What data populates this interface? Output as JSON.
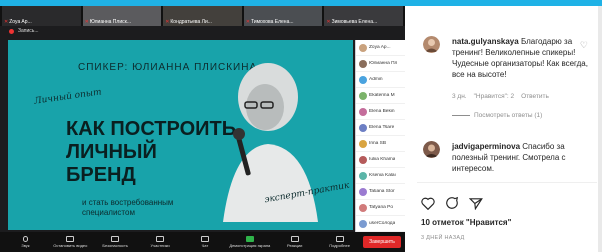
{
  "zoom": {
    "tiles": [
      {
        "name": "Zoya Ap..."
      },
      {
        "name": "Юлианна Плиск..."
      },
      {
        "name": "Кондратьева Ли..."
      },
      {
        "name": "Тимохова Елена..."
      },
      {
        "name": "Зимовьева Елена..."
      }
    ],
    "rec_label": "Запись...",
    "slide": {
      "speaker": "СПИКЕР: ЮЛИАННА ПЛИСКИНА",
      "handwritten_left": "Личный опыт",
      "title": "КАК ПОСТРОИТЬ\nЛИЧНЫЙ\nБРЕНД",
      "subtitle": "и стать востребованным\nспециалистом",
      "handwritten_right": "эксперт-практик"
    },
    "participants": [
      {
        "name": "Zoya Ap...",
        "color": "#c9a27e"
      },
      {
        "name": "Юлианна Пл",
        "color": "#8a6e5c"
      },
      {
        "name": "Admin",
        "color": "#4aa3df"
      },
      {
        "name": "Ekaterina M",
        "color": "#7bb36a"
      },
      {
        "name": "Elena Bekin",
        "color": "#c46d9b"
      },
      {
        "name": "Elena Tsare",
        "color": "#6d7fc4"
      },
      {
        "name": "Irina SB",
        "color": "#d9a441"
      },
      {
        "name": "Iuliia Khama",
        "color": "#b55b5b"
      },
      {
        "name": "Ksenia Kalai",
        "color": "#5bb5a8"
      },
      {
        "name": "Tatiana Stor",
        "color": "#9b7bd1"
      },
      {
        "name": "Tatyana Po",
        "color": "#d17b7b"
      },
      {
        "name": "userCолода",
        "color": "#7b9bd1"
      },
      {
        "name": "Anhonov",
        "color": "#a8a8a8"
      }
    ],
    "toolbar": {
      "items": [
        "Звук",
        "Остановить видео",
        "Безопасность",
        "Участники",
        "Чат",
        "Демонстрация экрана",
        "Реакции",
        "Подробнее"
      ],
      "participants_count": "68",
      "end_label": "Завершить"
    },
    "bottom_left": {
      "invite": "Пригласить",
      "other": "Вкл"
    }
  },
  "instagram": {
    "comment1": {
      "username": "nata.gulyanskaya",
      "text": "Благодарю за тренинг! Великолепные спикеры! Чудесные организаторы! Как всегда, все на высоте!",
      "time": "3 дн.",
      "likes": "\"Нравится\": 2",
      "reply": "Ответить",
      "view_replies": "Посмотреть ответы (1)"
    },
    "comment2": {
      "username": "jadvigaperminova",
      "text": "Спасибо за полезный тренинг. Смотрела с интересом."
    },
    "likes_total": "10 отметок \"Нравится\"",
    "posted_ago": "3 ДНЕЙ НАЗАД",
    "icons": [
      "heart-icon",
      "comment-icon",
      "share-icon"
    ]
  }
}
